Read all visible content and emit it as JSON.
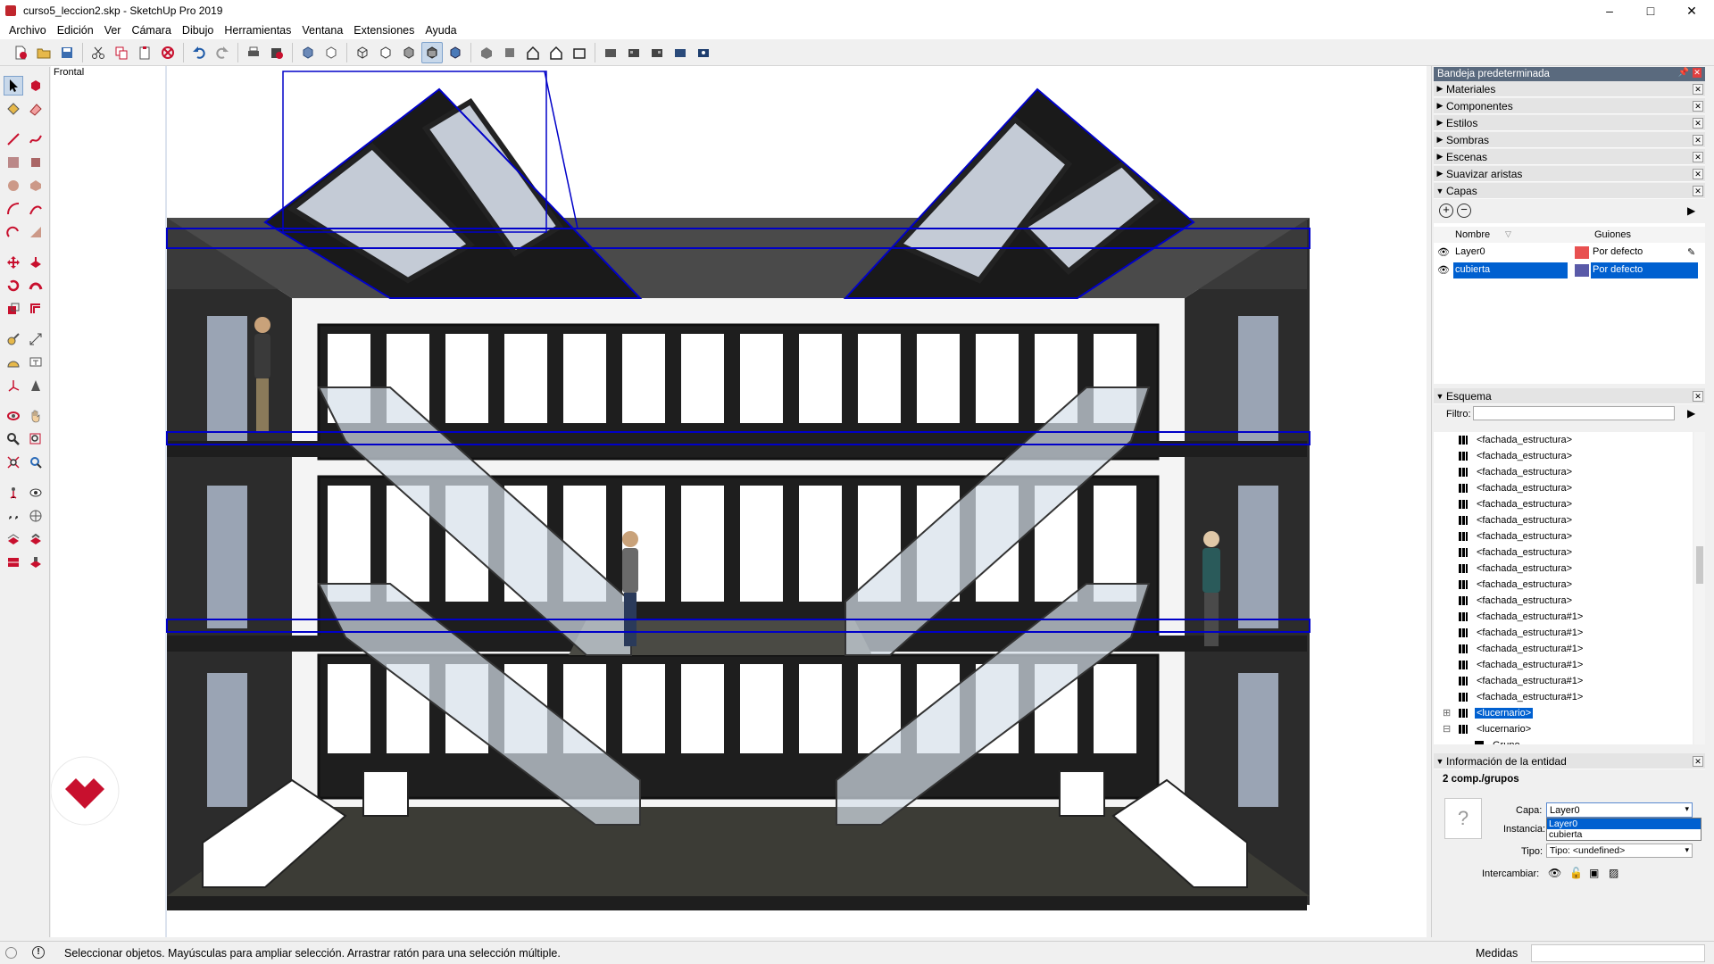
{
  "window": {
    "title": "curso5_leccion2.skp - SketchUp Pro 2019",
    "controls": {
      "minimize": "–",
      "maximize": "□",
      "close": "✕"
    }
  },
  "menu": [
    "Archivo",
    "Edición",
    "Ver",
    "Cámara",
    "Dibujo",
    "Herramientas",
    "Ventana",
    "Extensiones",
    "Ayuda"
  ],
  "viewport": {
    "scene_label": "Frontal"
  },
  "tray": {
    "title": "Bandeja predeterminada",
    "panels": [
      "Materiales",
      "Componentes",
      "Estilos",
      "Sombras",
      "Escenas",
      "Suavizar aristas",
      "Capas"
    ],
    "layers": {
      "col_name": "Nombre",
      "col_dash": "Guiones",
      "rows": [
        {
          "name": "Layer0",
          "dash": "Por defecto",
          "color": "#e85050",
          "selected": false
        },
        {
          "name": "cubierta",
          "dash": "Por defecto",
          "color": "#5a5aa8",
          "selected": true
        }
      ]
    },
    "outliner": {
      "title": "Esquema",
      "filter_label": "Filtro:",
      "filter_value": "",
      "items": [
        "<fachada_estructura>",
        "<fachada_estructura>",
        "<fachada_estructura>",
        "<fachada_estructura>",
        "<fachada_estructura>",
        "<fachada_estructura>",
        "<fachada_estructura>",
        "<fachada_estructura>",
        "<fachada_estructura>",
        "<fachada_estructura>",
        "<fachada_estructura>",
        "<fachada_estructura#1>",
        "<fachada_estructura#1>",
        "<fachada_estructura#1>",
        "<fachada_estructura#1>",
        "<fachada_estructura#1>",
        "<fachada_estructura#1>",
        "<lucernario>",
        "<lucernario>",
        "Grupo"
      ]
    },
    "entity_info": {
      "title": "Información de la entidad",
      "summary": "2 comp./grupos",
      "layer_label": "Capa:",
      "layer_value": "Layer0",
      "dropdown_options": [
        "Layer0",
        "cubierta"
      ],
      "instance_label": "Instancia:",
      "type_label": "Tipo:",
      "type_value": "Tipo: <undefined>",
      "toggle_label": "Intercambiar:"
    }
  },
  "status": {
    "text": "Seleccionar objetos. Mayúsculas para ampliar selección. Arrastrar ratón para una selección múltiple.",
    "measurements_label": "Medidas",
    "measurements_value": ""
  },
  "colors": {
    "selection_blue": "#0000c8",
    "brand_red": "#c8102e",
    "highlight": "#0060d0"
  }
}
